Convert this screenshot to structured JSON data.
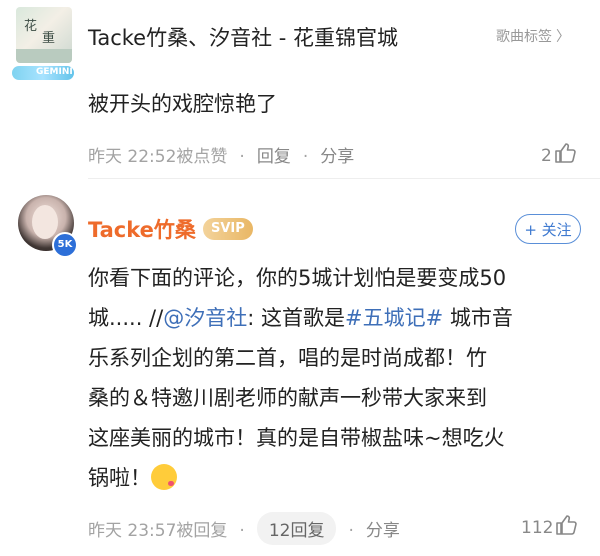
{
  "header": {
    "cover_text_1": "花",
    "cover_text_2": "重",
    "song_title": "Tacke竹桑、汐音社 - 花重锦官城",
    "tag_link": "歌曲标签",
    "tag_chevron": "〉"
  },
  "badge_text": "GEMINI",
  "comment1": {
    "text": "被开头的戏腔惊艳了",
    "time": "昨天 22:52被点赞",
    "sep": "·",
    "reply_label": "回复",
    "share_label": "分享",
    "like_count": "2"
  },
  "comment2": {
    "avatar_badge": "5K",
    "username": "Tacke竹桑",
    "vip": "SVIP",
    "follow_label": "+ 关注",
    "lines": {
      "l1": "你看下面的评论，你的5城计划怕是要变成50",
      "l2_a": "城..... //",
      "l2_mention": "@汐音社",
      "l2_b": ": 这首歌是",
      "l2_hashtag": "#五城记#",
      "l2_c": " 城市音",
      "l3": "乐系列企划的第二首，唱的是时尚成都！竹",
      "l4": "桑的＆特邀川剧老师的献声一秒带大家来到",
      "l5": "这座美丽的城市！真的是自带椒盐味~想吃火",
      "l6": "锅啦！"
    },
    "time": "昨天 23:57被回复",
    "sep": "·",
    "reply_count_label": "12回复",
    "share_label": "分享",
    "like_count": "112"
  },
  "icons": {
    "like": "thumbs-up-icon",
    "kiss_emoji": "kissing-face-icon"
  },
  "colors": {
    "username": "#ee6b2b",
    "link": "#3e6fb8",
    "meta": "#a3a3a3",
    "follow": "#3f7ad0",
    "svip_gold": "#e9b765"
  }
}
